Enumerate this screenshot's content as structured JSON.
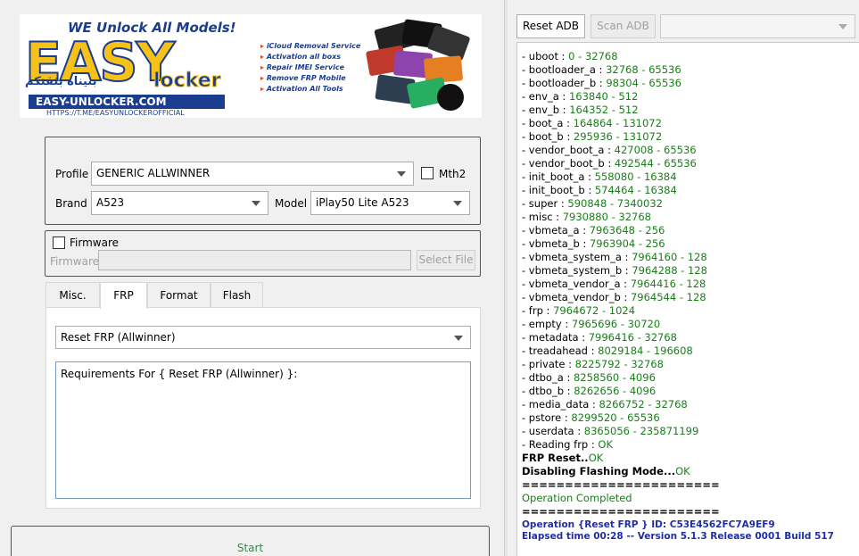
{
  "banner": {
    "tagline": "WE Unlock All Models!",
    "logo_main": "EASY",
    "logo_sub": "locker",
    "arabic": "بنيناه بثقتكم",
    "url": "EASY-UNLOCKER.COM",
    "url2": "HTTPS://T.ME/EASYUNLOCKEROFFICIAL",
    "services": [
      "iCloud Removal Service",
      "Activation all boxs",
      "Repair IMEI Service",
      "Remove FRP Mobile",
      "Activation All Tools"
    ]
  },
  "device": {
    "profile_label": "Profile",
    "profile_value": "GENERIC ALLWINNER",
    "mth2_label": "Mth2",
    "brand_label": "Brand",
    "brand_value": "A523",
    "model_label": "Model",
    "model_value": "iPlay50 Lite A523"
  },
  "firmware": {
    "checkbox_label": "Firmware",
    "field_label": "Firmware",
    "select_file": "Select File"
  },
  "tabs": [
    {
      "label": "Misc."
    },
    {
      "label": "FRP"
    },
    {
      "label": "Format"
    },
    {
      "label": "Flash"
    }
  ],
  "frp": {
    "operation_value": "Reset FRP  (Allwinner)",
    "requirements": "Requirements For { Reset FRP  (Allwinner) }:"
  },
  "start_label": "Start",
  "toolbar": {
    "reset_adb": "Reset ADB",
    "scan_adb": "Scan ADB",
    "port_value": ""
  },
  "log": {
    "partitions": [
      {
        "name": "uboot",
        "value": "0 - 32768"
      },
      {
        "name": "bootloader_a",
        "value": "32768 - 65536"
      },
      {
        "name": "bootloader_b",
        "value": "98304 - 65536"
      },
      {
        "name": "env_a",
        "value": "163840 - 512"
      },
      {
        "name": "env_b",
        "value": "164352 - 512"
      },
      {
        "name": "boot_a",
        "value": "164864 - 131072"
      },
      {
        "name": "boot_b",
        "value": "295936 - 131072"
      },
      {
        "name": "vendor_boot_a",
        "value": "427008 - 65536"
      },
      {
        "name": "vendor_boot_b",
        "value": "492544 - 65536"
      },
      {
        "name": "init_boot_a",
        "value": "558080 - 16384"
      },
      {
        "name": "init_boot_b",
        "value": "574464 - 16384"
      },
      {
        "name": "super",
        "value": "590848 - 7340032"
      },
      {
        "name": "misc",
        "value": "7930880 - 32768"
      },
      {
        "name": "vbmeta_a",
        "value": "7963648 - 256"
      },
      {
        "name": "vbmeta_b",
        "value": "7963904 - 256"
      },
      {
        "name": "vbmeta_system_a",
        "value": "7964160 - 128"
      },
      {
        "name": "vbmeta_system_b",
        "value": "7964288 - 128"
      },
      {
        "name": "vbmeta_vendor_a",
        "value": "7964416 - 128"
      },
      {
        "name": "vbmeta_vendor_b",
        "value": "7964544 - 128"
      },
      {
        "name": "frp",
        "value": "7964672 - 1024"
      },
      {
        "name": "empty",
        "value": "7965696 - 30720"
      },
      {
        "name": "metadata",
        "value": "7996416 - 32768"
      },
      {
        "name": "treadahead",
        "value": "8029184 - 196608"
      },
      {
        "name": "private",
        "value": "8225792 - 32768"
      },
      {
        "name": "dtbo_a",
        "value": "8258560 - 4096"
      },
      {
        "name": "dtbo_b",
        "value": "8262656 - 4096"
      },
      {
        "name": "media_data",
        "value": "8266752 - 32768"
      },
      {
        "name": "pstore",
        "value": "8299520 - 65536"
      },
      {
        "name": "userdata",
        "value": "8365056 - 235871199"
      }
    ],
    "reading_frp": "- Reading frp : ",
    "reading_frp_status": "OK",
    "frp_reset": "FRP Reset..",
    "frp_reset_status": "OK",
    "disabling": "Disabling Flashing Mode...",
    "disabling_status": "OK",
    "separator": "=======================",
    "completed": "Operation Completed",
    "operation_id": "Operation {Reset FRP } ID: C53E4562FC7A9EF9",
    "elapsed": "Elapsed time 00:28 -- Version 5.1.3 Release 0001 Build 517"
  }
}
